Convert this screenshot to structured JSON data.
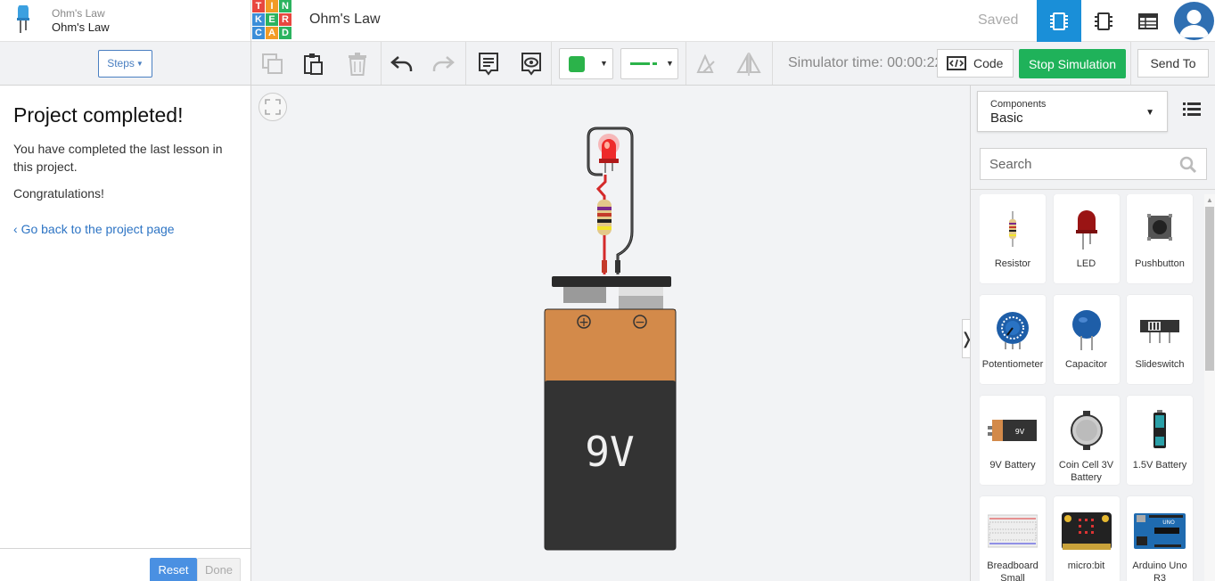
{
  "lesson": {
    "parent_title": "Ohm's Law",
    "current_title": "Ohm's Law",
    "steps_label": "Steps",
    "heading": "Project completed!",
    "paragraph1": "You have completed the last lesson in this project.",
    "paragraph2": "Congratulations!",
    "back_link": "Go back to the project page",
    "reset_label": "Reset",
    "done_label": "Done"
  },
  "header": {
    "logo_letters": [
      "T",
      "I",
      "N",
      "K",
      "E",
      "R",
      "C",
      "A",
      "D"
    ],
    "logo_colors": [
      "#e8473f",
      "#f29b25",
      "#2bb35f",
      "#3b8ed8",
      "#2bb35f",
      "#e8473f",
      "#3b8ed8",
      "#f29b25",
      "#2bb35f"
    ],
    "project_title": "Ohm's Law",
    "save_status": "Saved",
    "accent_color": "#1a8fd8"
  },
  "toolbar": {
    "simulator_time": "Simulator time: 00:00:22",
    "code_label": "Code",
    "stop_label": "Stop Simulation",
    "send_label": "Send To",
    "wire_color": "#2bb34a",
    "stop_color": "#1fb25a"
  },
  "canvas": {
    "battery_label": "9V",
    "plus_sign": "+",
    "minus_sign": "−"
  },
  "panel": {
    "components_label": "Components",
    "category": "Basic",
    "search_placeholder": "Search",
    "items": [
      {
        "name": "Resistor",
        "icon": "resistor-icon"
      },
      {
        "name": "LED",
        "icon": "led-icon"
      },
      {
        "name": "Pushbutton",
        "icon": "pushbutton-icon"
      },
      {
        "name": "Potentiometer",
        "icon": "potentiometer-icon"
      },
      {
        "name": "Capacitor",
        "icon": "capacitor-icon"
      },
      {
        "name": "Slideswitch",
        "icon": "slideswitch-icon"
      },
      {
        "name": "9V Battery",
        "icon": "battery-9v-icon"
      },
      {
        "name": "Coin Cell 3V Battery",
        "icon": "coin-cell-icon"
      },
      {
        "name": "1.5V Battery",
        "icon": "battery-aa-icon"
      },
      {
        "name": "Breadboard Small",
        "icon": "breadboard-icon"
      },
      {
        "name": "micro:bit",
        "icon": "microbit-icon"
      },
      {
        "name": "Arduino Uno R3",
        "icon": "arduino-icon"
      }
    ]
  }
}
